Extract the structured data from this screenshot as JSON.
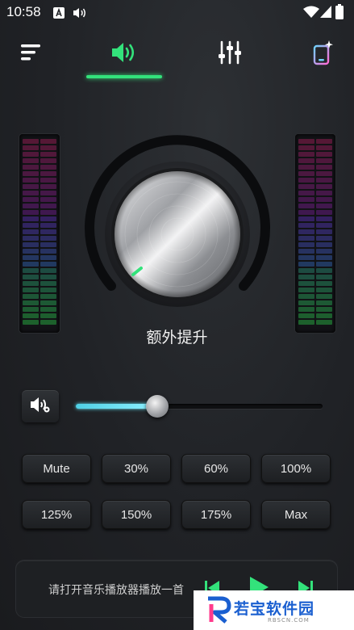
{
  "status_bar": {
    "time": "10:58",
    "icons": [
      "keyboard-a-icon",
      "audio-icon",
      "wifi-icon",
      "signal-icon",
      "battery-icon"
    ]
  },
  "tabs": {
    "items": [
      {
        "name": "menu",
        "icon": "menu-icon"
      },
      {
        "name": "volume",
        "icon": "speaker-icon",
        "active": true
      },
      {
        "name": "equalizer",
        "icon": "equalizer-icon"
      },
      {
        "name": "theme",
        "icon": "phone-sparkle-icon"
      }
    ],
    "accent": "#33e27b"
  },
  "knob": {
    "label": "额外提升",
    "ring_color": "#0b0c0e",
    "indicator_color": "#33e27b"
  },
  "volume": {
    "level_fraction": 0.33,
    "fill_color": "#5ee3f5"
  },
  "presets": {
    "row1": [
      "Mute",
      "30%",
      "60%",
      "100%"
    ],
    "row2": [
      "125%",
      "150%",
      "175%",
      "Max"
    ]
  },
  "player": {
    "message": "请打开音乐播放器播放一首",
    "controls": [
      "previous-icon",
      "play-icon",
      "next-icon"
    ]
  },
  "watermark": {
    "text": "若宝软件园",
    "subtext": "RBSCN.COM"
  }
}
